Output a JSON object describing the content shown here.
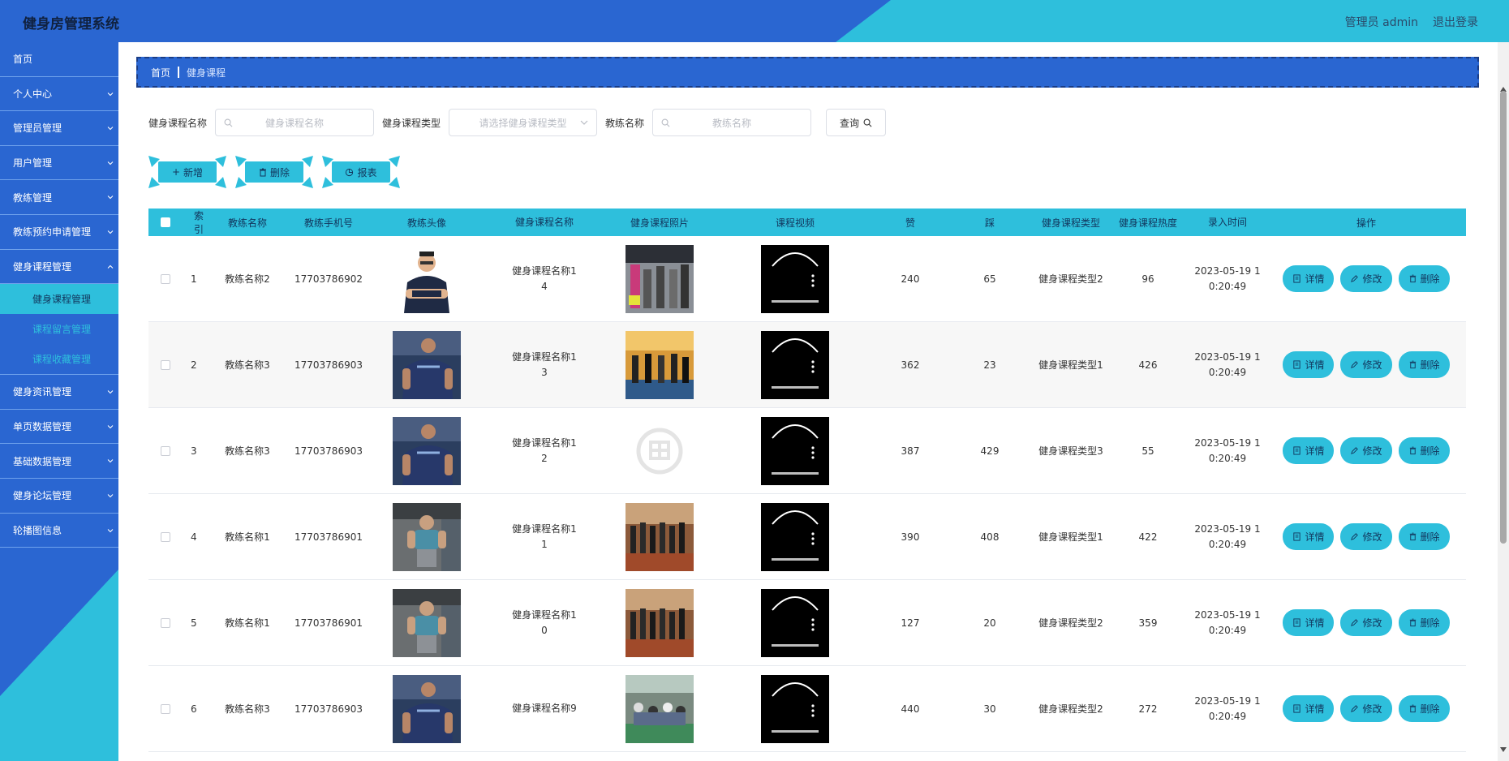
{
  "app": {
    "title": "健身房管理系统",
    "user_label": "管理员 admin",
    "logout_label": "退出登录"
  },
  "colors": {
    "primary_blue": "#2a66d1",
    "accent_cyan": "#2ebfdc",
    "dark_text": "#12355c"
  },
  "sidebar": {
    "items": [
      {
        "label": "首页",
        "has_children": false
      },
      {
        "label": "个人中心",
        "has_children": true
      },
      {
        "label": "管理员管理",
        "has_children": true
      },
      {
        "label": "用户管理",
        "has_children": true
      },
      {
        "label": "教练管理",
        "has_children": true
      },
      {
        "label": "教练预约申请管理",
        "has_children": true
      },
      {
        "label": "健身课程管理",
        "has_children": true,
        "expanded": true
      }
    ],
    "subitems": [
      {
        "label": "健身课程管理",
        "active": true
      },
      {
        "label": "课程留言管理",
        "active": false
      },
      {
        "label": "课程收藏管理",
        "active": false
      }
    ],
    "items_after": [
      {
        "label": "健身资讯管理",
        "has_children": true
      },
      {
        "label": "单页数据管理",
        "has_children": true
      },
      {
        "label": "基础数据管理",
        "has_children": true
      },
      {
        "label": "健身论坛管理",
        "has_children": true
      },
      {
        "label": "轮播图信息",
        "has_children": true
      }
    ]
  },
  "breadcrumb": {
    "home": "首页",
    "current": "健身课程"
  },
  "search": {
    "course_name_label": "健身课程名称",
    "course_name_placeholder": "健身课程名称",
    "course_type_label": "健身课程类型",
    "course_type_placeholder": "请选择健身课程类型",
    "coach_name_label": "教练名称",
    "coach_name_placeholder": "教练名称",
    "query_label": "查询"
  },
  "actions": {
    "add_label": "新增",
    "delete_label": "删除",
    "report_label": "报表"
  },
  "table": {
    "headers": {
      "index": "索引",
      "coach_name": "教练名称",
      "coach_phone": "教练手机号",
      "coach_avatar": "教练头像",
      "course_name": "健身课程名称",
      "course_photo": "健身课程照片",
      "course_video": "课程视频",
      "likes": "赞",
      "dislikes": "踩",
      "course_type": "健身课程类型",
      "course_heat": "健身课程热度",
      "entry_time": "录入时间",
      "operations": "操作"
    },
    "row_actions": {
      "detail": "详情",
      "edit": "修改",
      "delete": "删除"
    },
    "rows": [
      {
        "index": "1",
        "coach_name": "教练名称2",
        "coach_phone": "17703786902",
        "avatar": "coach-2",
        "course_name_l1": "健身课程名称1",
        "course_name_l2": "4",
        "photo": "gym-class-a",
        "likes": "240",
        "dislikes": "65",
        "course_type": "健身课程类型2",
        "heat": "96",
        "time_l1": "2023-05-19 1",
        "time_l2": "0:20:49"
      },
      {
        "index": "2",
        "coach_name": "教练名称3",
        "coach_phone": "17703786903",
        "avatar": "coach-3",
        "course_name_l1": "健身课程名称1",
        "course_name_l2": "3",
        "photo": "gym-class-b",
        "likes": "362",
        "dislikes": "23",
        "course_type": "健身课程类型1",
        "heat": "426",
        "time_l1": "2023-05-19 1",
        "time_l2": "0:20:49"
      },
      {
        "index": "3",
        "coach_name": "教练名称3",
        "coach_phone": "17703786903",
        "avatar": "coach-3",
        "course_name_l1": "健身课程名称1",
        "course_name_l2": "2",
        "photo": "placeholder-logo",
        "likes": "387",
        "dislikes": "429",
        "course_type": "健身课程类型3",
        "heat": "55",
        "time_l1": "2023-05-19 1",
        "time_l2": "0:20:49"
      },
      {
        "index": "4",
        "coach_name": "教练名称1",
        "coach_phone": "17703786901",
        "avatar": "coach-1",
        "course_name_l1": "健身课程名称1",
        "course_name_l2": "1",
        "photo": "gym-class-c",
        "likes": "390",
        "dislikes": "408",
        "course_type": "健身课程类型1",
        "heat": "422",
        "time_l1": "2023-05-19 1",
        "time_l2": "0:20:49"
      },
      {
        "index": "5",
        "coach_name": "教练名称1",
        "coach_phone": "17703786901",
        "avatar": "coach-1",
        "course_name_l1": "健身课程名称1",
        "course_name_l2": "0",
        "photo": "gym-class-c",
        "likes": "127",
        "dislikes": "20",
        "course_type": "健身课程类型2",
        "heat": "359",
        "time_l1": "2023-05-19 1",
        "time_l2": "0:20:49"
      },
      {
        "index": "6",
        "coach_name": "教练名称3",
        "coach_phone": "17703786903",
        "avatar": "coach-3",
        "course_name_l1": "健身课程名称9",
        "course_name_l2": "",
        "photo": "gym-class-d",
        "likes": "440",
        "dislikes": "30",
        "course_type": "健身课程类型2",
        "heat": "272",
        "time_l1": "2023-05-19 1",
        "time_l2": "0:20:49"
      }
    ]
  }
}
